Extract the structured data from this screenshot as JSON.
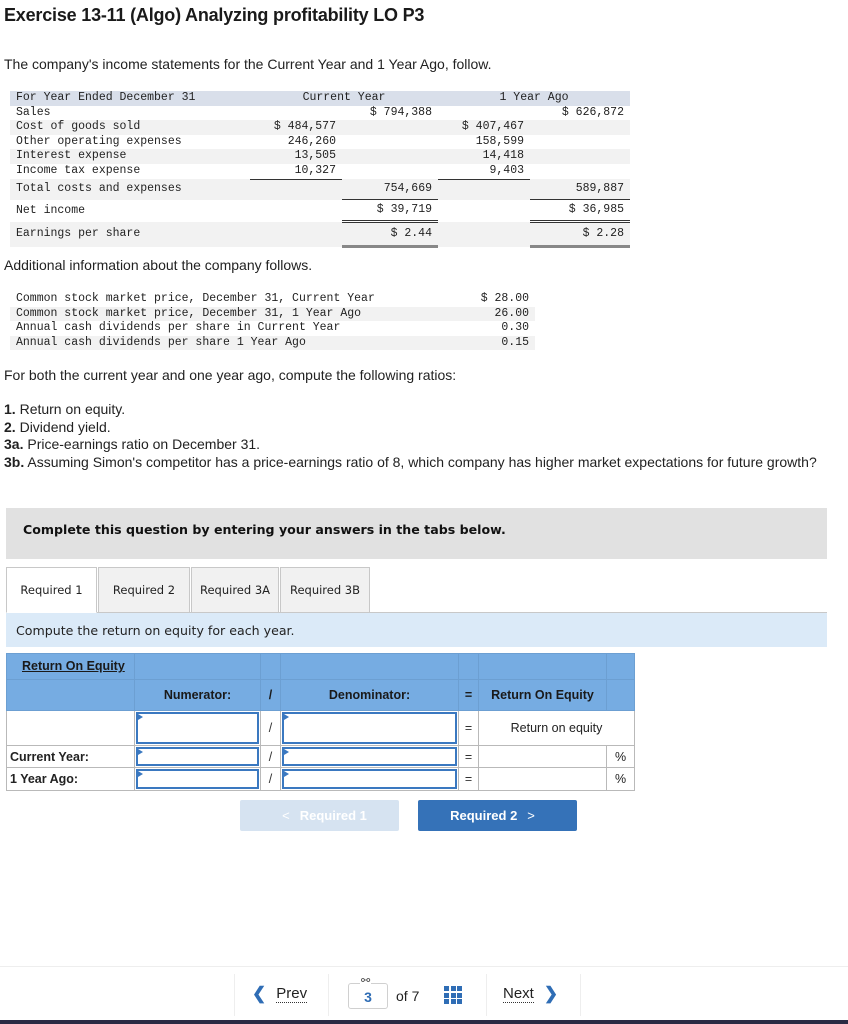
{
  "title": "Exercise 13-11 (Algo) Analyzing profitability LO P3",
  "intro": "The company's income statements for the Current Year and 1 Year Ago, follow.",
  "income_statement": {
    "header": {
      "label": "For Year Ended December 31",
      "current": "Current Year",
      "prior": "1 Year Ago"
    },
    "rows": [
      {
        "label": "Sales",
        "cur_item": "",
        "cur_total": "$ 794,388",
        "pri_item": "",
        "pri_total": "$ 626,872"
      },
      {
        "label": "Cost of goods sold",
        "cur_item": "$ 484,577",
        "cur_total": "",
        "pri_item": "$ 407,467",
        "pri_total": ""
      },
      {
        "label": "Other operating expenses",
        "cur_item": "246,260",
        "cur_total": "",
        "pri_item": "158,599",
        "pri_total": ""
      },
      {
        "label": "Interest expense",
        "cur_item": "13,505",
        "cur_total": "",
        "pri_item": "14,418",
        "pri_total": ""
      },
      {
        "label": "Income tax expense",
        "cur_item": "10,327",
        "cur_total": "",
        "pri_item": "9,403",
        "pri_total": ""
      },
      {
        "label": "Total costs and expenses",
        "cur_item": "",
        "cur_total": "754,669",
        "pri_item": "",
        "pri_total": "589,887"
      },
      {
        "label": "Net income",
        "cur_item": "",
        "cur_total": "$ 39,719",
        "pri_item": "",
        "pri_total": "$ 36,985"
      },
      {
        "label": "Earnings per share",
        "cur_item": "",
        "cur_total": "$ 2.44",
        "pri_item": "",
        "pri_total": "$ 2.28"
      }
    ]
  },
  "additional_intro": "Additional information about the company follows.",
  "additional_info": [
    {
      "label": "Common stock market price, December 31, Current Year",
      "value": "$ 28.00"
    },
    {
      "label": "Common stock market price, December 31, 1 Year Ago",
      "value": "26.00"
    },
    {
      "label": "Annual cash dividends per share in Current Year",
      "value": "0.30"
    },
    {
      "label": "Annual cash dividends per share 1 Year Ago",
      "value": "0.15"
    }
  ],
  "ratios_intro": "For both the current year and one year ago, compute the following ratios:",
  "requirements": [
    {
      "num": "1.",
      "text": " Return on equity."
    },
    {
      "num": "2.",
      "text": " Dividend yield."
    },
    {
      "num": "3a.",
      "text": " Price-earnings ratio on December 31."
    },
    {
      "num": "3b.",
      "text": " Assuming Simon's competitor has a price-earnings ratio of 8, which company has higher market expectations for future growth?"
    }
  ],
  "complete_box": "Complete this question by entering your answers in the tabs below.",
  "tabs": [
    {
      "label": "Required 1",
      "active": true
    },
    {
      "label": "Required 2",
      "active": false
    },
    {
      "label": "Required 3A",
      "active": false
    },
    {
      "label": "Required 3B",
      "active": false
    }
  ],
  "instruction": "Compute the return on equity for each year.",
  "roe_table": {
    "title": "Return On Equity",
    "numerator_header": "Numerator:",
    "slash": "/",
    "denominator_header": "Denominator:",
    "equals": "=",
    "result_header": "Return On Equity",
    "formula_row": {
      "label": "",
      "numerator": "",
      "denominator": "",
      "result": "Return on equity"
    },
    "rows": [
      {
        "label": "Current Year:",
        "numerator": "",
        "denominator": "",
        "result": "",
        "unit": "%"
      },
      {
        "label": "1 Year Ago:",
        "numerator": "",
        "denominator": "",
        "result": "",
        "unit": "%"
      }
    ]
  },
  "nav_buttons": {
    "prev_label": "Required 1",
    "next_label": "Required 2",
    "prev_chevron": "<",
    "next_chevron": ">"
  },
  "pager": {
    "prev_label": "Prev",
    "next_label": "Next",
    "current_page": "3",
    "of_label": "of 7",
    "prev_arrow": "❮",
    "next_arrow": "❯",
    "link_icon": "⚯"
  },
  "colors": {
    "accent": "#3572b8",
    "header_blue": "#76ace2",
    "instruction_bg": "#dbeaf8",
    "disabled_button": "#d6e3f1"
  }
}
